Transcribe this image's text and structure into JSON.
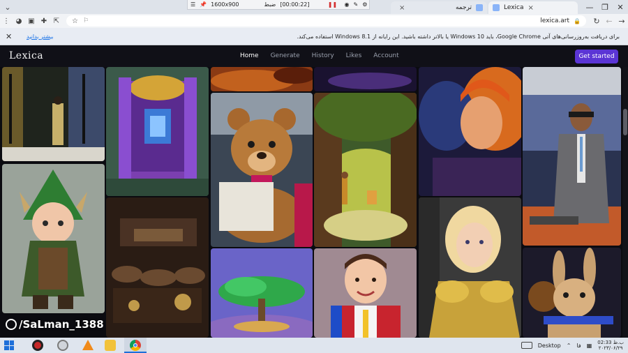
{
  "browser": {
    "tabs": [
      {
        "title": "Lexica",
        "active": true
      },
      {
        "title": "ترجمه",
        "active": false
      }
    ],
    "recorder": {
      "resolution": "1600x900",
      "label": "ضبط",
      "time": "[00:00:22]"
    },
    "url": "lexica.art"
  },
  "infobar": {
    "message": "برای دریافت به‌روزرسانی‌های آتی Google Chrome، باید Windows 10 یا بالاتر داشته باشید. این رایانه از Windows 8.1 استفاده می‌کند.",
    "dismiss": "بیشتر بدانید"
  },
  "site": {
    "logo": "Lexica",
    "nav": [
      "Home",
      "Generate",
      "History",
      "Likes",
      "Account"
    ],
    "active_nav": "Home",
    "cta": "Get started",
    "watermark": "/SaLman_1388"
  },
  "taskbar": {
    "desktop_label": "Desktop",
    "lang": "فا",
    "time": "ب.ظ 02:33",
    "date": "۲۰۲۳/۰۶/۲۹"
  }
}
